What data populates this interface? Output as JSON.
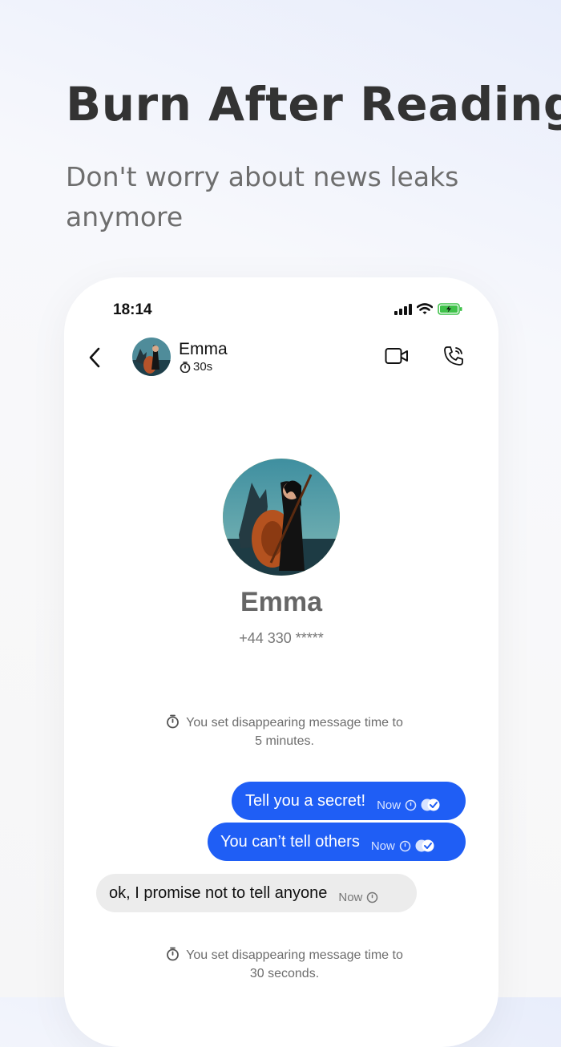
{
  "headline": "Burn After Reading",
  "subheadline": "Don't worry about news leaks anymore",
  "status_bar": {
    "time": "18:14"
  },
  "chat_header": {
    "contact_name": "Emma",
    "timer": "30s"
  },
  "profile": {
    "name": "Emma",
    "phone": "+44 330 *****"
  },
  "system_messages": [
    {
      "line1": "You set disappearing message time to",
      "line2": "5 minutes."
    },
    {
      "line1": "You set disappearing message time to",
      "line2": "30 seconds."
    }
  ],
  "messages": [
    {
      "direction": "outgoing",
      "text": "Tell you a secret!",
      "time": "Now"
    },
    {
      "direction": "outgoing",
      "text": "You can’t tell others",
      "time": "Now"
    },
    {
      "direction": "incoming",
      "text": "ok, I promise not to tell anyone",
      "time": "Now"
    }
  ],
  "colors": {
    "accent": "#1f5ef5",
    "incoming_bubble": "#ececec",
    "battery": "#3fc24a"
  },
  "icons": [
    "back-icon",
    "video-call-icon",
    "phone-call-icon",
    "timer-icon",
    "read-check-icon",
    "signal-icon",
    "wifi-icon",
    "battery-icon"
  ]
}
